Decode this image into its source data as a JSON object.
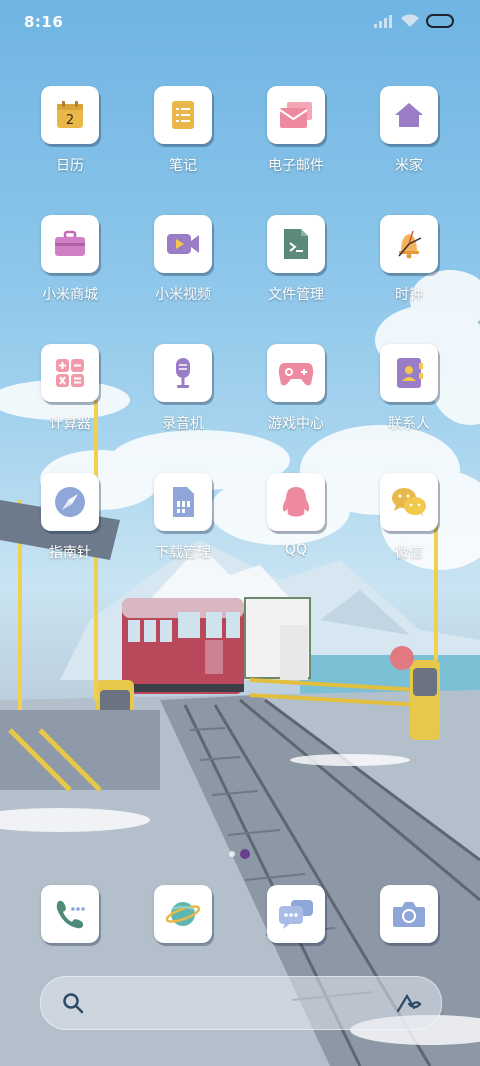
{
  "status_bar": {
    "time": "8:16",
    "icons": [
      "signal-icon",
      "wifi-icon",
      "battery-icon"
    ]
  },
  "apps": [
    {
      "label": "日历",
      "icon": "calendar-icon",
      "icon_text": "2"
    },
    {
      "label": "笔记",
      "icon": "notes-icon"
    },
    {
      "label": "电子邮件",
      "icon": "email-icon"
    },
    {
      "label": "米家",
      "icon": "home-icon"
    },
    {
      "label": "小米商城",
      "icon": "briefcase-icon"
    },
    {
      "label": "小米视频",
      "icon": "video-camera-icon"
    },
    {
      "label": "文件管理",
      "icon": "file-manager-icon"
    },
    {
      "label": "时钟",
      "icon": "clock-icon"
    },
    {
      "label": "计算器",
      "icon": "calculator-icon"
    },
    {
      "label": "录音机",
      "icon": "microphone-icon"
    },
    {
      "label": "游戏中心",
      "icon": "gamepad-icon"
    },
    {
      "label": "联系人",
      "icon": "contacts-icon"
    },
    {
      "label": "指南针",
      "icon": "compass-icon"
    },
    {
      "label": "下载管理",
      "icon": "download-sim-icon"
    },
    {
      "label": "QQ",
      "icon": "qq-penguin-icon"
    },
    {
      "label": "微信",
      "icon": "wechat-icon"
    }
  ],
  "page_indicator": {
    "pages": 2,
    "current": 2
  },
  "dock": [
    {
      "icon": "phone-icon"
    },
    {
      "icon": "browser-planet-icon"
    },
    {
      "icon": "messages-icon"
    },
    {
      "icon": "camera-icon"
    }
  ],
  "search": {
    "icons": [
      "search-icon",
      "assistant-icon"
    ]
  },
  "colors": {
    "accent_purple": "#9b7cc6",
    "accent_yellow": "#e8b84a",
    "accent_pink": "#ee8aa0",
    "accent_green": "#5c8a7a",
    "accent_blue": "#8fa6d9",
    "sky": "#8cc6ea",
    "page_dot_active": "#6b3f8f"
  }
}
